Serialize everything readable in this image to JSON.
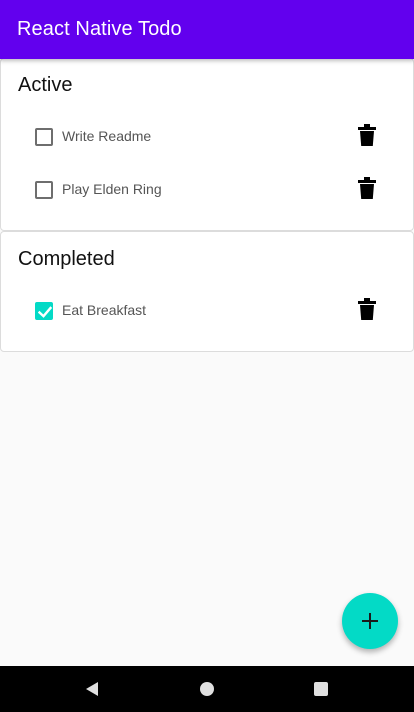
{
  "app": {
    "title": "React Native Todo",
    "accent_color": "#6200ee",
    "secondary_color": "#03dac6"
  },
  "sections": [
    {
      "title": "Active",
      "items": [
        {
          "label": "Write Readme",
          "checked": false,
          "delete_icon": "trash-icon"
        },
        {
          "label": "Play Elden Ring",
          "checked": false,
          "delete_icon": "trash-icon"
        }
      ]
    },
    {
      "title": "Completed",
      "items": [
        {
          "label": "Eat Breakfast",
          "checked": true,
          "delete_icon": "trash-icon"
        }
      ]
    }
  ],
  "fab": {
    "icon": "plus-icon"
  },
  "system_nav": {
    "back_icon": "back-triangle-icon",
    "home_icon": "home-circle-icon",
    "recents_icon": "recents-square-icon"
  }
}
